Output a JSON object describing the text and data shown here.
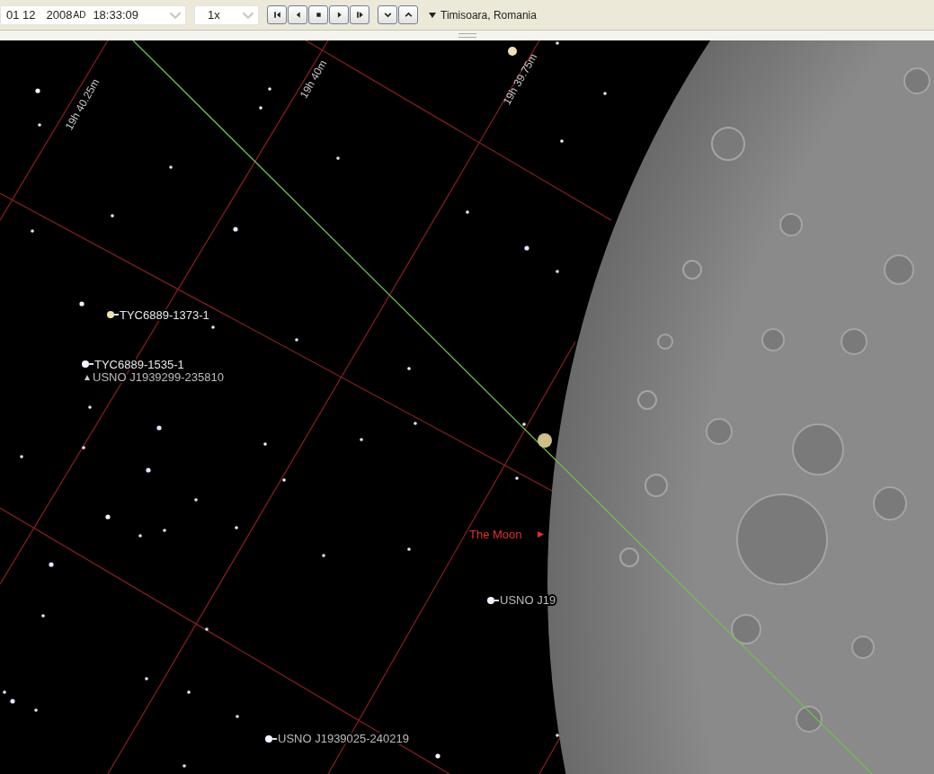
{
  "toolbar": {
    "date": "01 12",
    "year": "2008",
    "era": "AD",
    "time": "18:33:09",
    "speed": "1x",
    "location": "Timisoara, Romania"
  },
  "sky": {
    "grid_labels": [
      "19h 40.25m",
      "19h 40m",
      "19h 39.75m"
    ],
    "star_labels": [
      {
        "text": "TYC6889-1373-1",
        "kind": "tick"
      },
      {
        "text": "TYC6889-1535-1",
        "kind": "tick"
      },
      {
        "text": "USNO J1939299-235810",
        "kind": "triangle"
      },
      {
        "text": "USNO J19",
        "kind": "tick"
      },
      {
        "text": "USNO J1939025-240219",
        "kind": "tick"
      }
    ],
    "moon_label": "The Moon"
  }
}
